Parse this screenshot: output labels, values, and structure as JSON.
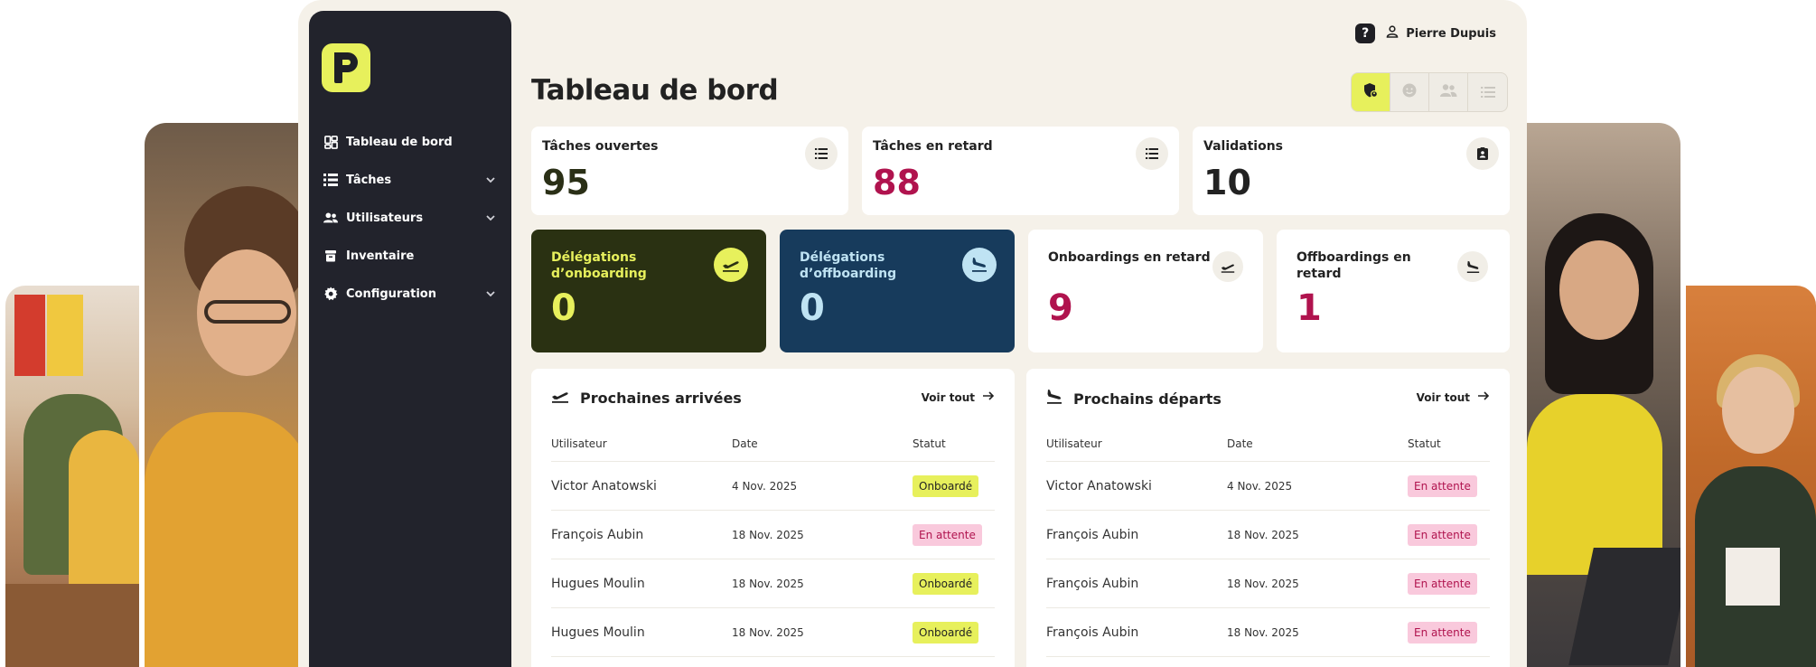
{
  "colors": {
    "accent": "#e7f05c",
    "sidebar": "#22232c",
    "danger_text": "#b0134e",
    "deleg_on_bg": "#2a3112",
    "deleg_off_bg": "#173b5c",
    "deleg_off_text": "#bfe3f3"
  },
  "user": {
    "name": "Pierre Dupuis",
    "help_label": "?"
  },
  "sidebar": {
    "items": [
      {
        "label": "Tableau de bord",
        "icon": "dashboard-icon",
        "expandable": false
      },
      {
        "label": "Tâches",
        "icon": "task-list-icon",
        "expandable": true
      },
      {
        "label": "Utilisateurs",
        "icon": "users-icon",
        "expandable": true
      },
      {
        "label": "Inventaire",
        "icon": "inventory-icon",
        "expandable": false
      },
      {
        "label": "Configuration",
        "icon": "gear-icon",
        "expandable": true
      }
    ]
  },
  "page": {
    "title": "Tableau de bord"
  },
  "view_switch": [
    "shield-user-icon",
    "smiley-icon",
    "group-icon",
    "list-icon"
  ],
  "stats": [
    {
      "label": "Tâches ouvertes",
      "value": "95",
      "icon": "list-icon",
      "value_color": "#2a2f16"
    },
    {
      "label": "Tâches en retard",
      "value": "88",
      "icon": "list-icon",
      "value_color": "#b0134e"
    },
    {
      "label": "Validations",
      "value": "10",
      "icon": "clipboard-user-icon",
      "value_color": "#222222"
    }
  ],
  "delegations": [
    {
      "label": "Délégations d’onboarding",
      "value": "0",
      "icon": "plane-takeoff-icon"
    },
    {
      "label": "Délégations d’offboarding",
      "value": "0",
      "icon": "plane-landing-icon"
    }
  ],
  "late": [
    {
      "label": "Onboardings en retard",
      "value": "9",
      "icon": "plane-takeoff-icon"
    },
    {
      "label": "Offboardings en retard",
      "value": "1",
      "icon": "plane-landing-icon"
    }
  ],
  "arrivals": {
    "title": "Prochaines arrivées",
    "see_all": "Voir tout",
    "columns": [
      "Utilisateur",
      "Date",
      "Statut"
    ],
    "rows": [
      {
        "user": "Victor Anatowski",
        "date": "4 Nov. 2025",
        "status": "Onboardé",
        "kind": "on"
      },
      {
        "user": "François Aubin",
        "date": "18 Nov. 2025",
        "status": "En attente",
        "kind": "wait"
      },
      {
        "user": "Hugues Moulin",
        "date": "18 Nov. 2025",
        "status": "Onboardé",
        "kind": "on"
      },
      {
        "user": "Hugues Moulin",
        "date": "18 Nov. 2025",
        "status": "Onboardé",
        "kind": "on"
      }
    ]
  },
  "departures": {
    "title": "Prochains départs",
    "see_all": "Voir tout",
    "columns": [
      "Utilisateur",
      "Date",
      "Statut"
    ],
    "rows": [
      {
        "user": "Victor Anatowski",
        "date": "4 Nov. 2025",
        "status": "En attente",
        "kind": "wait"
      },
      {
        "user": "François Aubin",
        "date": "18 Nov. 2025",
        "status": "En attente",
        "kind": "wait"
      },
      {
        "user": "François Aubin",
        "date": "18 Nov. 2025",
        "status": "En attente",
        "kind": "wait"
      },
      {
        "user": "François Aubin",
        "date": "18 Nov. 2025",
        "status": "En attente",
        "kind": "wait"
      }
    ]
  }
}
